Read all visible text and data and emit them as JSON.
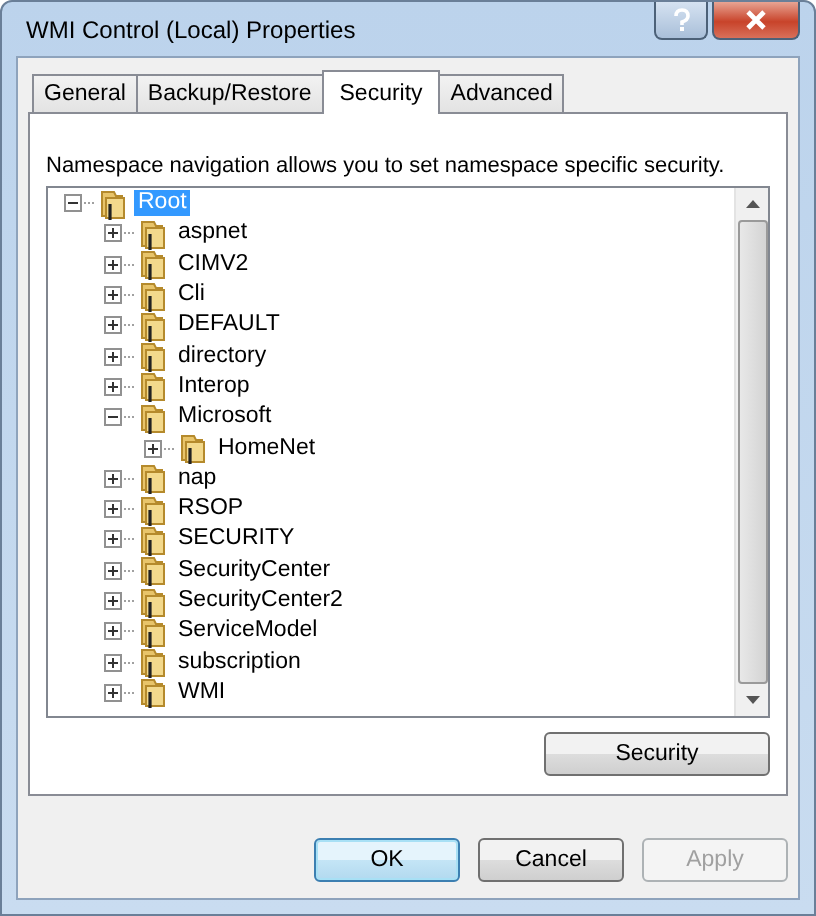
{
  "window": {
    "title": "WMI Control (Local) Properties"
  },
  "tabs": [
    {
      "label": "General",
      "selected": false
    },
    {
      "label": "Backup/Restore",
      "selected": false
    },
    {
      "label": "Security",
      "selected": true
    },
    {
      "label": "Advanced",
      "selected": false
    }
  ],
  "description": "Namespace navigation allows you to set namespace specific security.",
  "tree": [
    {
      "label": "Root",
      "expanded": true,
      "selected": true,
      "children": [
        {
          "label": "aspnet",
          "expanded": false,
          "selected": false
        },
        {
          "label": "CIMV2",
          "expanded": false,
          "selected": false
        },
        {
          "label": "Cli",
          "expanded": false,
          "selected": false
        },
        {
          "label": "DEFAULT",
          "expanded": false,
          "selected": false
        },
        {
          "label": "directory",
          "expanded": false,
          "selected": false
        },
        {
          "label": "Interop",
          "expanded": false,
          "selected": false
        },
        {
          "label": "Microsoft",
          "expanded": true,
          "selected": false,
          "children": [
            {
              "label": "HomeNet",
              "expanded": false,
              "selected": false
            }
          ]
        },
        {
          "label": "nap",
          "expanded": false,
          "selected": false
        },
        {
          "label": "RSOP",
          "expanded": false,
          "selected": false
        },
        {
          "label": "SECURITY",
          "expanded": false,
          "selected": false
        },
        {
          "label": "SecurityCenter",
          "expanded": false,
          "selected": false
        },
        {
          "label": "SecurityCenter2",
          "expanded": false,
          "selected": false
        },
        {
          "label": "ServiceModel",
          "expanded": false,
          "selected": false
        },
        {
          "label": "subscription",
          "expanded": false,
          "selected": false
        },
        {
          "label": "WMI",
          "expanded": false,
          "selected": false
        }
      ]
    }
  ],
  "security_button": "Security",
  "buttons": [
    {
      "label": "OK",
      "kind": "default",
      "disabled": false
    },
    {
      "label": "Cancel",
      "kind": "normal",
      "disabled": false
    },
    {
      "label": "Apply",
      "kind": "normal",
      "disabled": true
    }
  ]
}
